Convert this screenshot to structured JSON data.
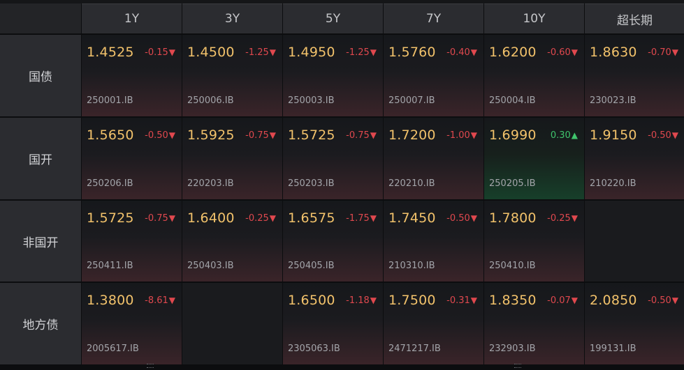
{
  "columns": [
    "1Y",
    "3Y",
    "5Y",
    "7Y",
    "10Y",
    "超长期"
  ],
  "rows": [
    {
      "label": "国债",
      "cells": [
        {
          "yield": "1.4525",
          "change": "-0.15",
          "dir": "down",
          "code": "250001.IB"
        },
        {
          "yield": "1.4500",
          "change": "-1.25",
          "dir": "down",
          "code": "250006.IB"
        },
        {
          "yield": "1.4950",
          "change": "-1.25",
          "dir": "down",
          "code": "250003.IB"
        },
        {
          "yield": "1.5760",
          "change": "-0.40",
          "dir": "down",
          "code": "250007.IB"
        },
        {
          "yield": "1.6200",
          "change": "-0.60",
          "dir": "down",
          "code": "250004.IB"
        },
        {
          "yield": "1.8630",
          "change": "-0.70",
          "dir": "down",
          "code": "230023.IB"
        }
      ]
    },
    {
      "label": "国开",
      "cells": [
        {
          "yield": "1.5650",
          "change": "-0.50",
          "dir": "down",
          "code": "250206.IB"
        },
        {
          "yield": "1.5925",
          "change": "-0.75",
          "dir": "down",
          "code": "220203.IB"
        },
        {
          "yield": "1.5725",
          "change": "-0.75",
          "dir": "down",
          "code": "250203.IB"
        },
        {
          "yield": "1.7200",
          "change": "-1.00",
          "dir": "down",
          "code": "220210.IB"
        },
        {
          "yield": "1.6990",
          "change": "0.30",
          "dir": "up",
          "code": "250205.IB"
        },
        {
          "yield": "1.9150",
          "change": "-0.50",
          "dir": "down",
          "code": "210220.IB"
        }
      ]
    },
    {
      "label": "非国开",
      "cells": [
        {
          "yield": "1.5725",
          "change": "-0.75",
          "dir": "down",
          "code": "250411.IB"
        },
        {
          "yield": "1.6400",
          "change": "-0.25",
          "dir": "down",
          "code": "250403.IB"
        },
        {
          "yield": "1.6575",
          "change": "-1.75",
          "dir": "down",
          "code": "250405.IB"
        },
        {
          "yield": "1.7450",
          "change": "-0.50",
          "dir": "down",
          "code": "210310.IB"
        },
        {
          "yield": "1.7800",
          "change": "-0.25",
          "dir": "down",
          "code": "250410.IB"
        },
        null
      ]
    },
    {
      "label": "地方债",
      "cells": [
        {
          "yield": "1.3800",
          "change": "-8.61",
          "dir": "down",
          "code": "2005617.IB"
        },
        null,
        {
          "yield": "1.6500",
          "change": "-1.18",
          "dir": "down",
          "code": "2305063.IB"
        },
        {
          "yield": "1.7500",
          "change": "-0.31",
          "dir": "down",
          "code": "2471217.IB"
        },
        {
          "yield": "1.8350",
          "change": "-0.07",
          "dir": "down",
          "code": "232903.IB"
        },
        {
          "yield": "2.0850",
          "change": "-0.50",
          "dir": "down",
          "code": "199131.IB"
        }
      ]
    }
  ],
  "arrows": {
    "down": "▼",
    "up": "▲"
  },
  "colors": {
    "yield": "#f2c26b",
    "down": "#e0484e",
    "up": "#3fc46c",
    "code": "#a3a5aa",
    "header_bg": "#2b2c30"
  }
}
